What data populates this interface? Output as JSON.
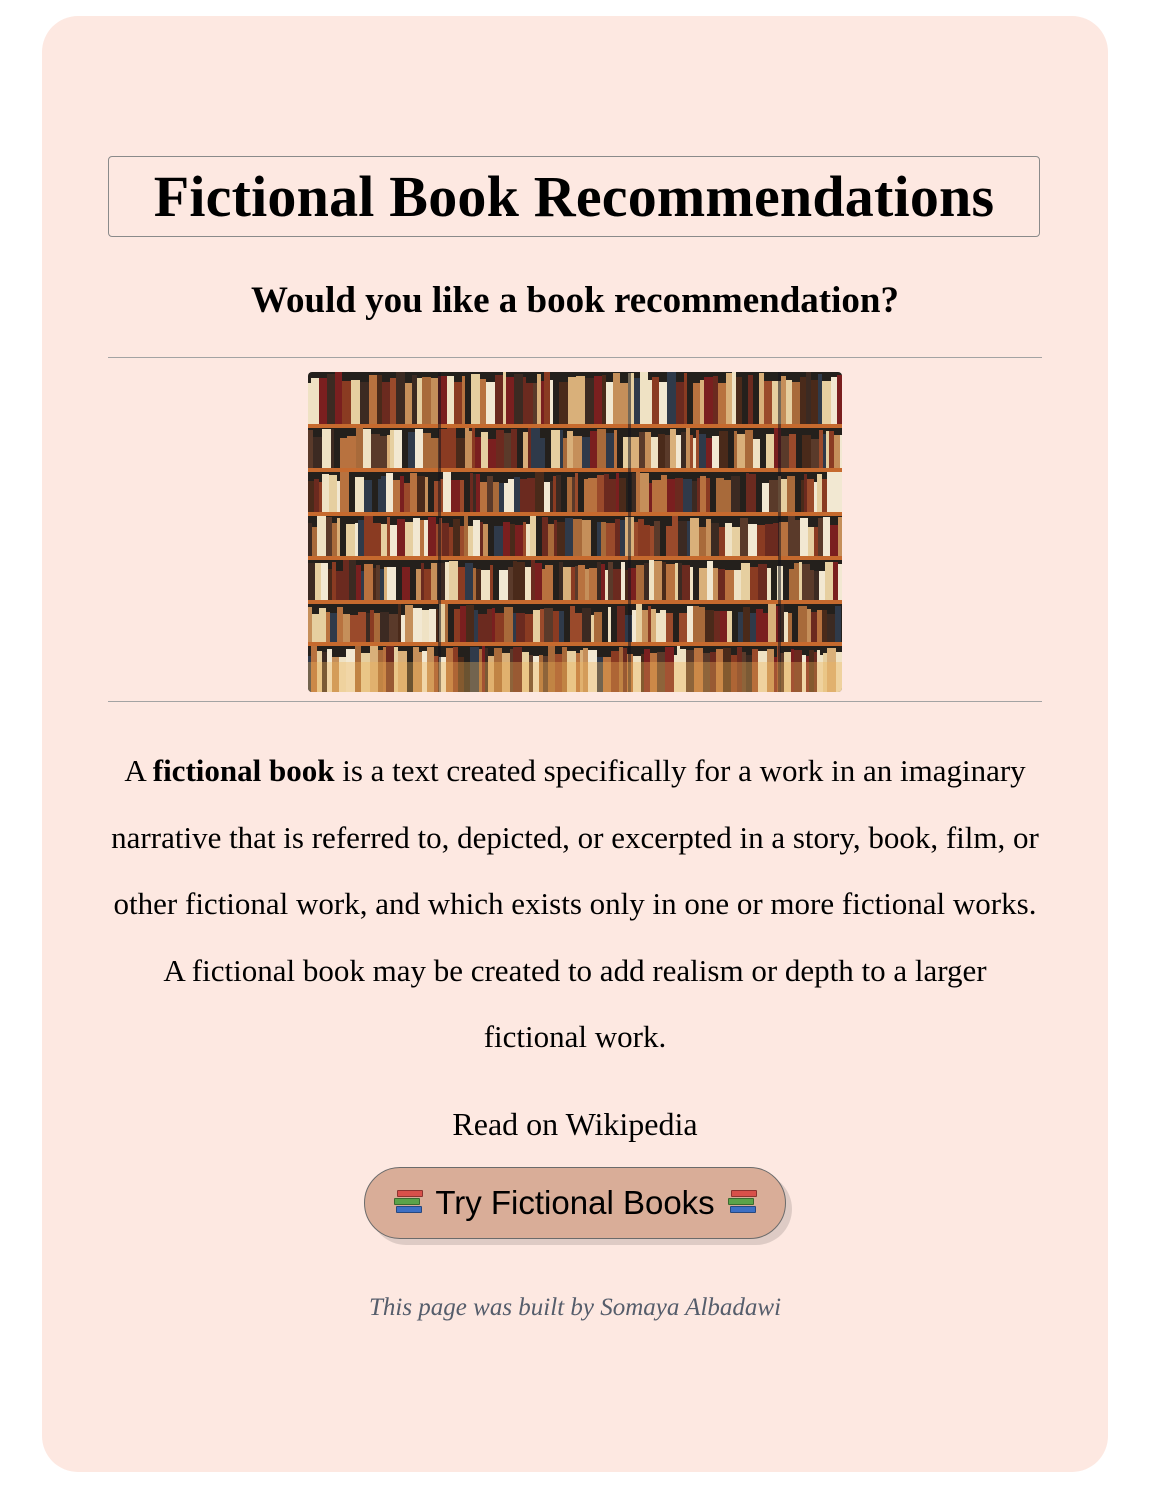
{
  "header": {
    "title": "Fictional Book Recommendations",
    "subtitle": "Would you like a book recommendation?"
  },
  "image": {
    "alt": "bookshelf image"
  },
  "description": {
    "lead": "A ",
    "bold_term": "fictional book",
    "rest": " is a text created specifically for a work in an imaginary narrative that is referred to, depicted, or excerpted in a story, book, film, or other fictional work, and which exists only in one or more fictional works. A fictional book may be created to add realism or depth to a larger fictional work."
  },
  "wiki_link": {
    "label": "Read on Wikipedia"
  },
  "try_button": {
    "label": "Try Fictional Books",
    "icon": "books-icon"
  },
  "footer": {
    "credit": "This page was built by Somaya Albadawi"
  },
  "colors": {
    "card_background": "#fde8e1",
    "button_background": "#d9ad98",
    "credit_text": "#555d6b"
  }
}
